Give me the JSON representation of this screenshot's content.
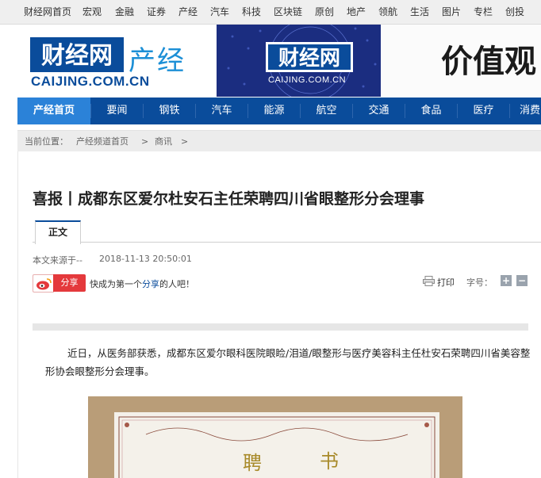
{
  "topnav": [
    "财经网首页",
    "宏观",
    "金融",
    "证券",
    "产经",
    "汽车",
    "科技",
    "区块链",
    "原创",
    "地产",
    "领航",
    "生活",
    "图片",
    "专栏",
    "创投"
  ],
  "header": {
    "logo_text": "财经网",
    "channel": "产经",
    "domain": "CAIJING.COM.CN",
    "banner_logo_text": "财经网",
    "banner_domain": "CAIJING.COM.CN",
    "banner_slogan": "价值观"
  },
  "mainnav": [
    "产经首页",
    "要闻",
    "钢铁",
    "汽车",
    "能源",
    "航空",
    "交通",
    "食品",
    "医疗",
    "消费"
  ],
  "breadcrumb": {
    "prefix": "当前位置：",
    "home": "产经频道首页",
    "sep1": ">",
    "section": "商讯",
    "sep2": ">"
  },
  "article": {
    "title": "喜报丨成都东区爱尔杜安石主任荣聘四川省眼整形分会理事",
    "tab": "正文",
    "source_label": "本文来源于--",
    "datetime": "2018-11-13 20:50:01",
    "share_button": "分享",
    "share_text_1": "快成为第一个",
    "share_link": "分享",
    "share_text_2": "的人吧！",
    "print": "打印",
    "fontsize": "字号：",
    "font_plus": "+",
    "font_minus": "−",
    "paragraph": "近日，从医务部获悉，成都东区爱尔眼科医院眼睑/泪道/眼整形与医疗美容科主任杜安石荣聘四川省美容整形协会眼整形分会理事。",
    "photo_text_1": "聘",
    "photo_text_2": "书"
  },
  "colors": {
    "nav_blue": "#0a4c9b",
    "nav_active": "#2b82d8",
    "share_red": "#e4393c"
  }
}
